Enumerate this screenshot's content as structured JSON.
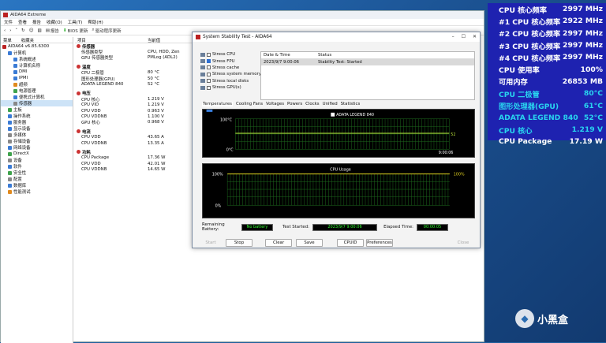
{
  "main": {
    "title": "AIDA64 Extreme",
    "menu": [
      "文件",
      "查看",
      "报告",
      "收藏(O)",
      "工具(T)",
      "帮助(H)"
    ],
    "toolbar": {
      "report": "报告",
      "bios": "BIOS 更新",
      "driver": "驱动程序更新"
    },
    "sidebar_head": [
      "菜单",
      "收藏夹"
    ],
    "tree": [
      {
        "label": "AIDA64 v6.85.6300",
        "indent": 0,
        "color": "#b22"
      },
      {
        "label": "计算机",
        "indent": 1,
        "color": "#3a7bd5"
      },
      {
        "label": "系统概述",
        "indent": 2,
        "color": "#3a7bd5"
      },
      {
        "label": "计算机名称",
        "indent": 2,
        "color": "#3a7bd5"
      },
      {
        "label": "DMI",
        "indent": 2,
        "color": "#3a7bd5"
      },
      {
        "label": "IPMI",
        "indent": 2,
        "color": "#3a7bd5"
      },
      {
        "label": "超频",
        "indent": 2,
        "color": "#e08a1e"
      },
      {
        "label": "电源管理",
        "indent": 2,
        "color": "#3fa34d"
      },
      {
        "label": "便携式计算机",
        "indent": 2,
        "color": "#3a7bd5"
      },
      {
        "label": "传感器",
        "indent": 2,
        "color": "#888",
        "selected": true
      },
      {
        "label": "主板",
        "indent": 1,
        "color": "#3fa34d"
      },
      {
        "label": "操作系统",
        "indent": 1,
        "color": "#3a7bd5"
      },
      {
        "label": "服务器",
        "indent": 1,
        "color": "#3a7bd5"
      },
      {
        "label": "显示设备",
        "indent": 1,
        "color": "#3a7bd5"
      },
      {
        "label": "多媒体",
        "indent": 1,
        "color": "#888"
      },
      {
        "label": "存储设备",
        "indent": 1,
        "color": "#888"
      },
      {
        "label": "网络设备",
        "indent": 1,
        "color": "#3a7bd5"
      },
      {
        "label": "DirectX",
        "indent": 1,
        "color": "#3fa34d"
      },
      {
        "label": "设备",
        "indent": 1,
        "color": "#888"
      },
      {
        "label": "软件",
        "indent": 1,
        "color": "#3a7bd5"
      },
      {
        "label": "安全性",
        "indent": 1,
        "color": "#3fa34d"
      },
      {
        "label": "配置",
        "indent": 1,
        "color": "#888"
      },
      {
        "label": "数据库",
        "indent": 1,
        "color": "#3a7bd5"
      },
      {
        "label": "性能测试",
        "indent": 1,
        "color": "#e08a1e"
      }
    ],
    "content_head": [
      "项目",
      "当前值"
    ],
    "rows": [
      {
        "t": "sec",
        "label": "传感器"
      },
      {
        "label": "传感器类型",
        "value": "CPU, HDD, Zen"
      },
      {
        "label": "GPU 传感器类型",
        "value": "PMLog  (ADL2)"
      },
      {
        "t": "gap"
      },
      {
        "t": "sec",
        "label": "温度"
      },
      {
        "label": "CPU 二极管",
        "value": "80 °C"
      },
      {
        "label": "图形处理器(GPU)",
        "value": "50 °C"
      },
      {
        "label": "ADATA LEGEND 840",
        "value": "52 °C"
      },
      {
        "t": "gap"
      },
      {
        "t": "sec",
        "label": "电压"
      },
      {
        "label": "CPU 核心",
        "value": "1.219 V"
      },
      {
        "label": "CPU VID",
        "value": "1.219 V"
      },
      {
        "label": "CPU VDD",
        "value": "0.963 V"
      },
      {
        "label": "CPU VDDNB",
        "value": "1.100 V"
      },
      {
        "label": "GPU 核心",
        "value": "0.968 V"
      },
      {
        "t": "gap"
      },
      {
        "t": "sec",
        "label": "电流"
      },
      {
        "label": "CPU VDD",
        "value": "43.65 A"
      },
      {
        "label": "CPU VDDNB",
        "value": "13.35 A"
      },
      {
        "t": "gap"
      },
      {
        "t": "sec",
        "label": "功耗"
      },
      {
        "label": "CPU Package",
        "value": "17.36 W"
      },
      {
        "label": "CPU VDD",
        "value": "42.01 W"
      },
      {
        "label": "CPU VDDNB",
        "value": "14.65 W"
      }
    ]
  },
  "dialog": {
    "title": "System Stability Test - AIDA64",
    "options": [
      {
        "label": "Stress CPU",
        "checked": false
      },
      {
        "label": "Stress FPU",
        "checked": true
      },
      {
        "label": "Stress cache",
        "checked": false
      },
      {
        "label": "Stress system memory",
        "checked": false
      },
      {
        "label": "Stress local disks",
        "checked": false
      },
      {
        "label": "Stress GPU(s)",
        "checked": false
      }
    ],
    "log_head": [
      "Date & Time",
      "Status"
    ],
    "log_row": [
      "2023/9/7 9:00:06",
      "Stability Test: Started"
    ],
    "tabs": [
      "Temperatures",
      "Cooling Fans",
      "Voltages",
      "Powers",
      "Clocks",
      "Unified",
      "Statistics"
    ],
    "temp_legend": "ADATA LEGEND 840",
    "temp_top": "100°C",
    "temp_bottom": "0°C",
    "temp_value": "52",
    "temp_time": "9:00:06",
    "usage_title": "CPU Usage",
    "usage_top": "100%",
    "usage_bottom": "0%",
    "usage_value": "100%",
    "battery_label": "Remaining Battery:",
    "battery_value": "No battery",
    "started_label": "Test Started:",
    "started_value": "2023/9/7 9:00:06",
    "elapsed_label": "Elapsed Time:",
    "elapsed_value": "00:00:05",
    "buttons": [
      "Start",
      "Stop",
      "Clear",
      "Save",
      "CPUID",
      "Preferences",
      "Close"
    ]
  },
  "osd": [
    {
      "label": "CPU 核心频率",
      "value": "2997 MHz"
    },
    {
      "label": "#1 CPU 核心频率",
      "value": "2922 MHz"
    },
    {
      "label": "#2 CPU 核心频率",
      "value": "2997 MHz"
    },
    {
      "label": "#3 CPU 核心频率",
      "value": "2997 MHz"
    },
    {
      "label": "#4 CPU 核心频率",
      "value": "2997 MHz"
    },
    {
      "label": "CPU 使用率",
      "value": "100%"
    },
    {
      "label": "可用内存",
      "value": "26853 MB"
    },
    {
      "label": "CPU 二极管",
      "value": "80°C",
      "cyan": true
    },
    {
      "label": "图形处理器(GPU)",
      "value": "61°C",
      "cyan": true
    },
    {
      "label": "ADATA LEGEND 840",
      "value": "52°C",
      "cyan": true
    },
    {
      "label": "CPU 核心",
      "value": "1.219 V",
      "cyan": true
    },
    {
      "label": "CPU Package",
      "value": "17.19 W"
    }
  ],
  "watermark": "小黑盒"
}
